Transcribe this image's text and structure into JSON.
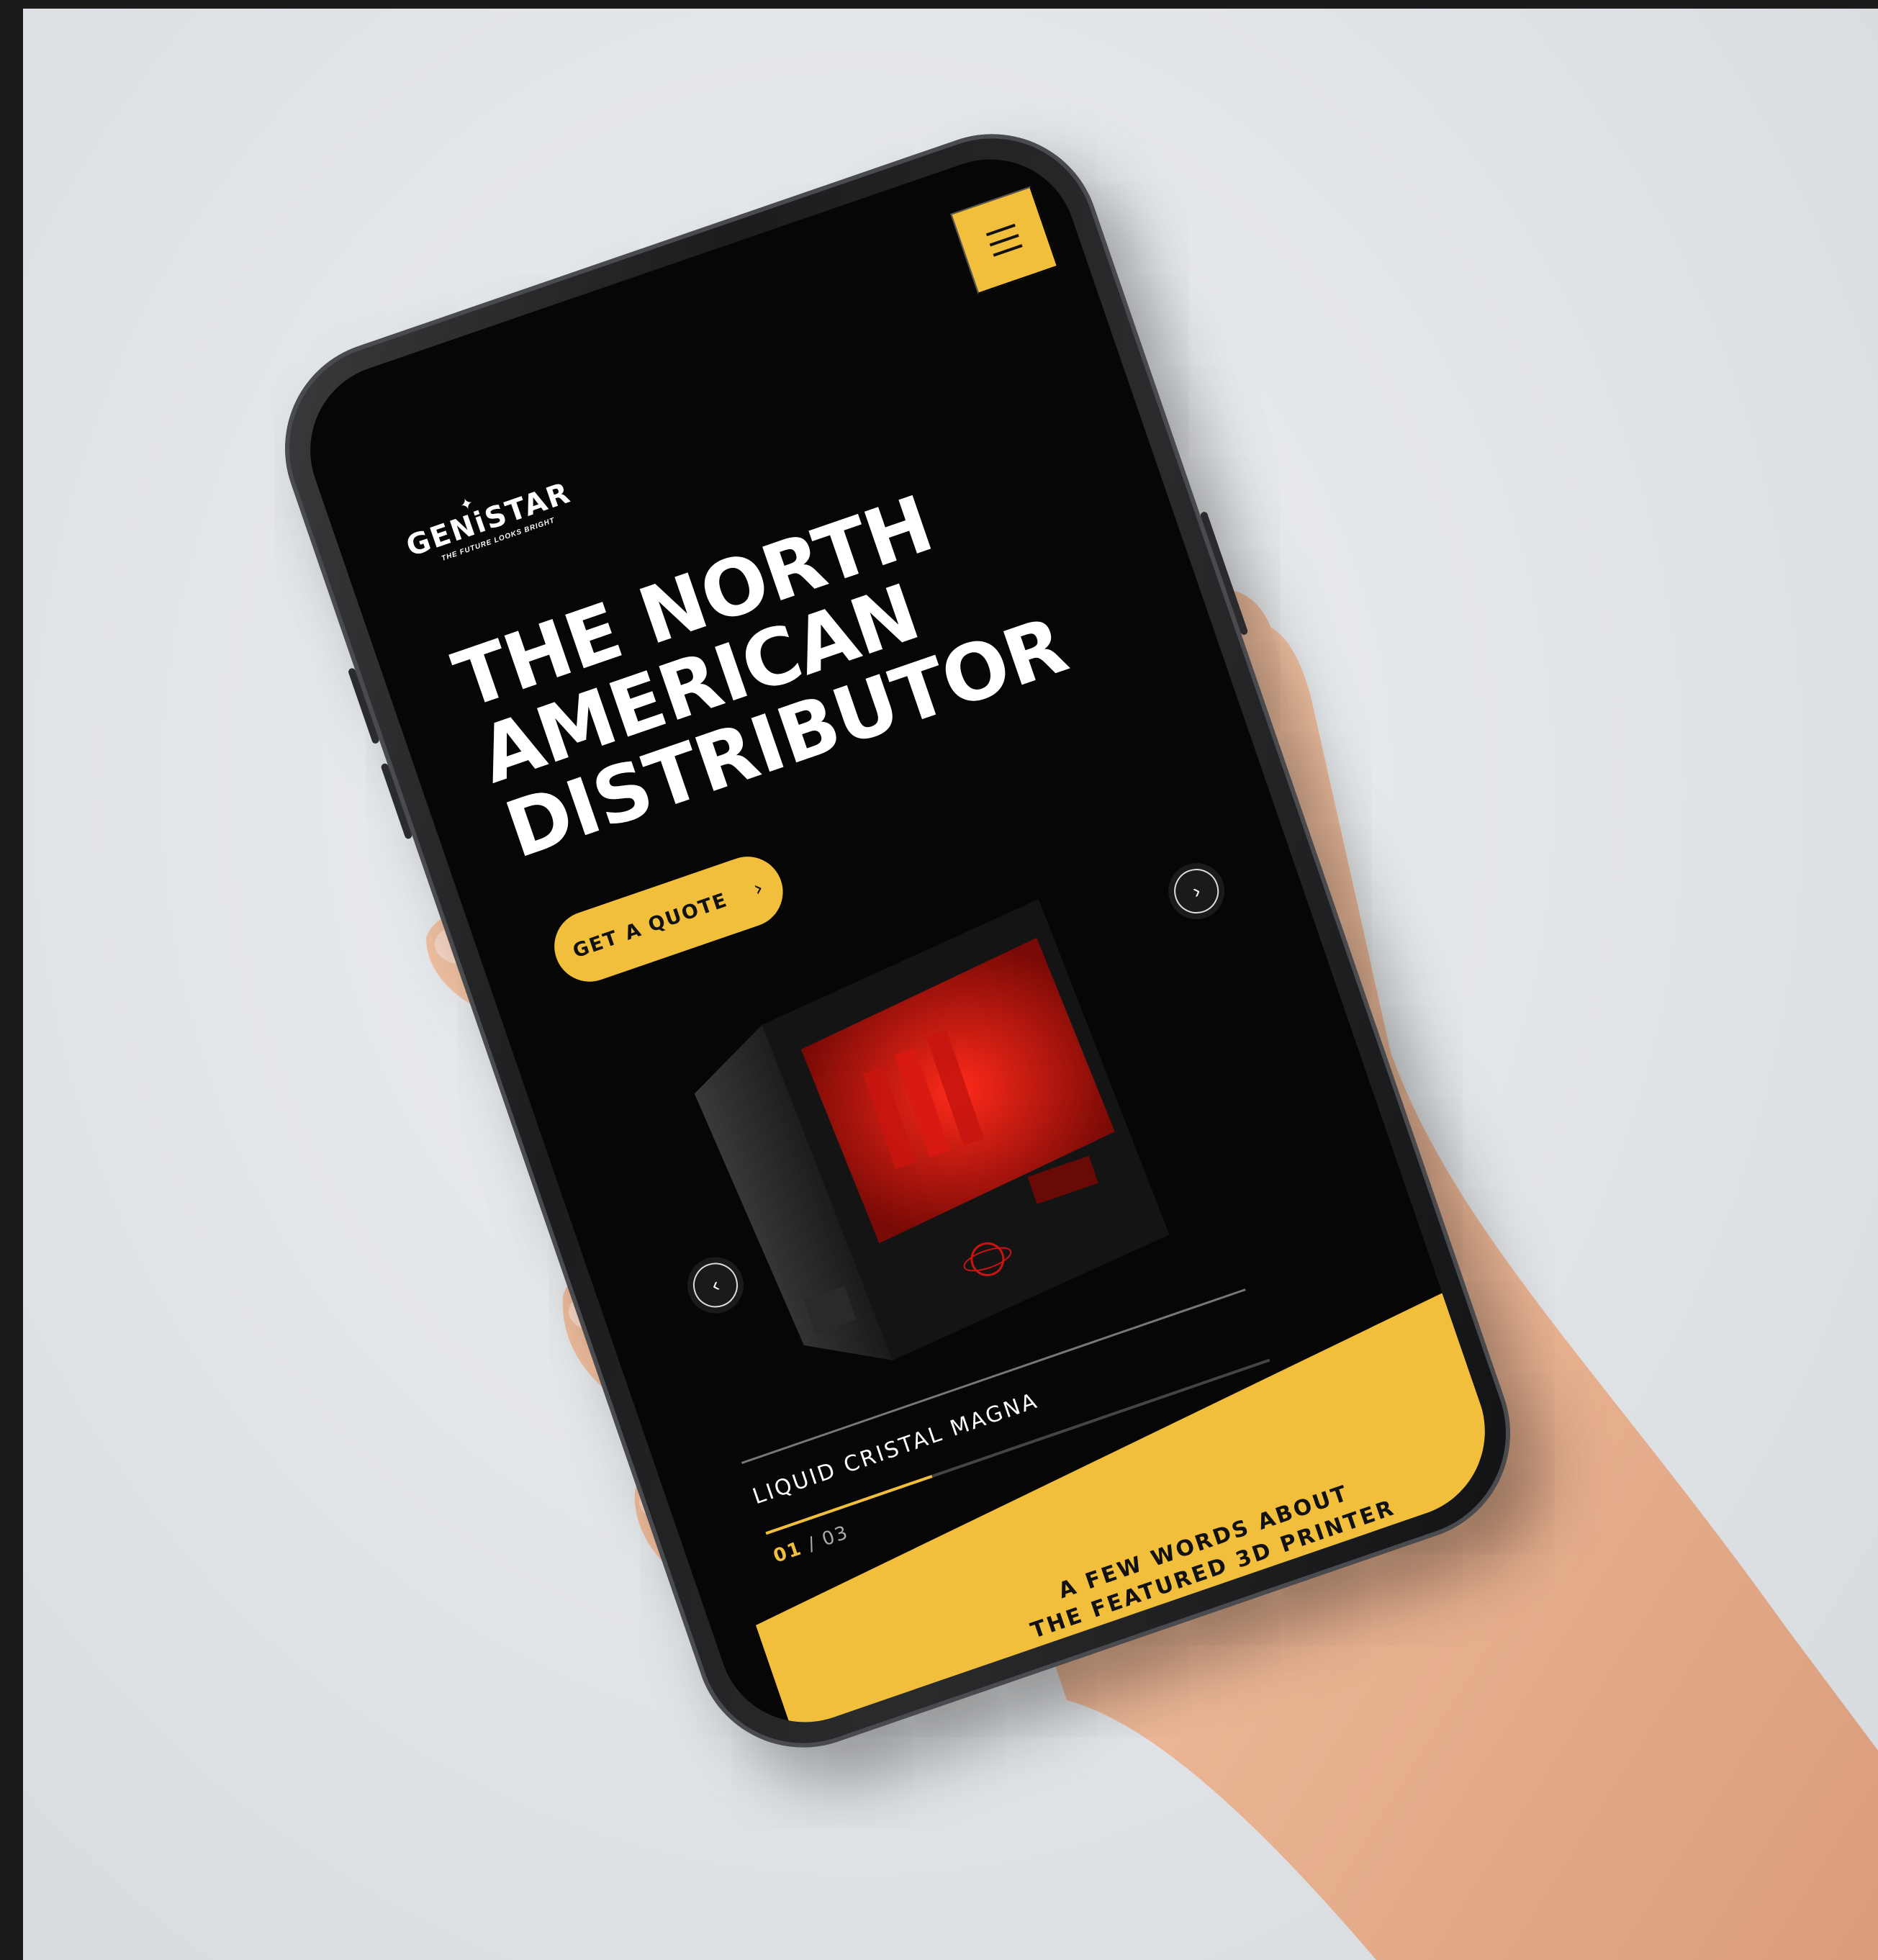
{
  "brand": {
    "logo_text": "GENiSTAR",
    "tagline": "THE FUTURE LOOKS BRIGHT",
    "accent_color": "#f1bf3c",
    "background_color": "#060606"
  },
  "header": {
    "menu_icon": "hamburger-menu-icon"
  },
  "hero": {
    "title_line_1": "THE NORTH",
    "title_line_2": "AMERICAN",
    "title_line_3": "DISTRIBUTOR",
    "cta_label": "GET A QUOTE",
    "cta_icon": "chevron-right-icon"
  },
  "slider": {
    "prev_icon": "chevron-left-icon",
    "next_icon": "chevron-right-icon",
    "product_name": "LIQUID CRISTAL MAGNA",
    "current": "01",
    "separator": "/",
    "total": "03",
    "progress": 0.33
  },
  "feature": {
    "line_1": "A FEW WORDS ABOUT",
    "line_2": "THE FEATURED 3D PRINTER"
  }
}
